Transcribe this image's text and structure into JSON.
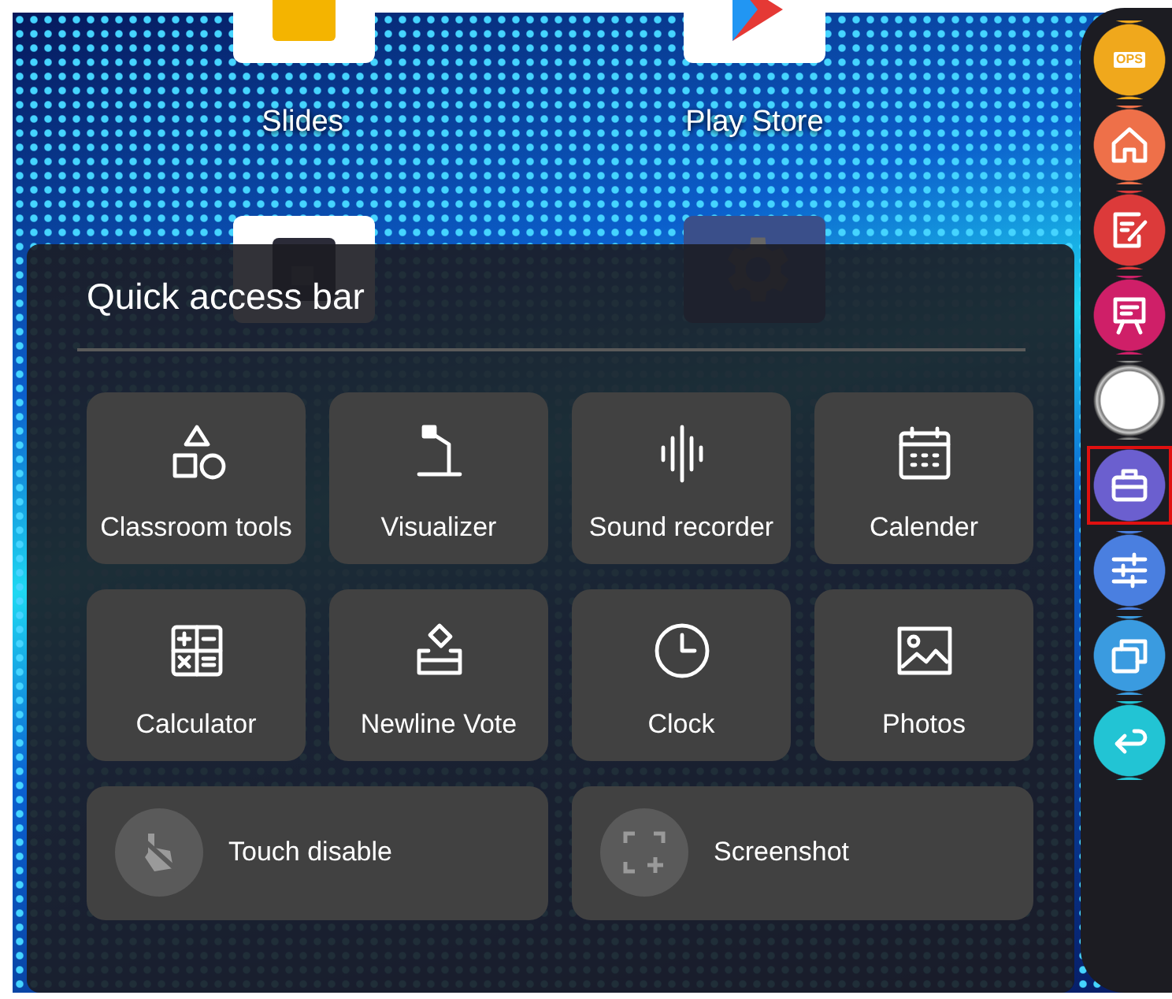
{
  "desktop": {
    "apps": [
      {
        "label": "Slides",
        "kind": "slides"
      },
      {
        "label": "Play Store",
        "kind": "store"
      },
      {
        "kind": "frame"
      },
      {
        "kind": "gear"
      }
    ]
  },
  "quick_access": {
    "title": "Quick access bar",
    "tiles": [
      {
        "label": "Classroom tools",
        "kind": "shapes"
      },
      {
        "label": "Visualizer",
        "kind": "lamp"
      },
      {
        "label": "Sound recorder",
        "kind": "wave"
      },
      {
        "label": "Calender",
        "kind": "calendar"
      },
      {
        "label": "Calculator",
        "kind": "calculator"
      },
      {
        "label": "Newline Vote",
        "kind": "vote"
      },
      {
        "label": "Clock",
        "kind": "clock"
      },
      {
        "label": "Photos",
        "kind": "photo"
      }
    ],
    "toggles": [
      {
        "label": "Touch disable",
        "kind": "touch"
      },
      {
        "label": "Screenshot",
        "kind": "screenshot"
      }
    ]
  },
  "sidebar": {
    "items": [
      {
        "kind": "ops",
        "label": "OPS",
        "color": "#f0a81c",
        "selected": false
      },
      {
        "kind": "home",
        "color": "#ee7049",
        "selected": false
      },
      {
        "kind": "note",
        "color": "#dc3a3a",
        "selected": false
      },
      {
        "kind": "easel",
        "color": "#cf1f68",
        "selected": false
      },
      {
        "kind": "circle",
        "color": "#ffffff",
        "selected": false
      },
      {
        "kind": "toolbox",
        "color": "#6b5fcf",
        "selected": true
      },
      {
        "kind": "sliders",
        "color": "#4a7fe0",
        "selected": false
      },
      {
        "kind": "windows",
        "color": "#3a9be0",
        "selected": false
      },
      {
        "kind": "back",
        "color": "#22c4d4",
        "selected": false
      }
    ]
  }
}
